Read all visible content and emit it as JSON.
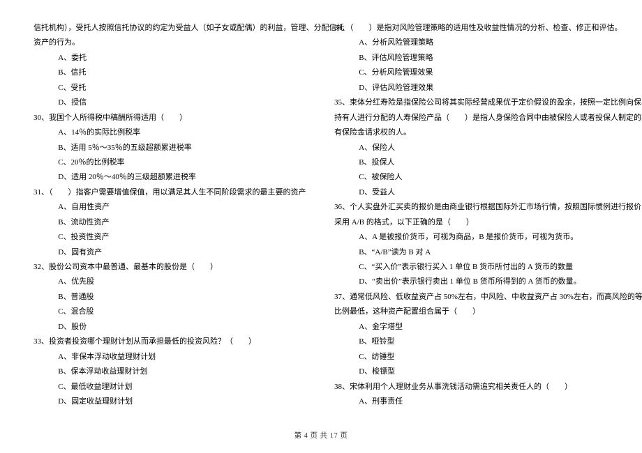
{
  "left": {
    "intro1": "信托机构），受托人按照信托协议的约定为受益人（如子女或配偶）的利益，管理、分配信托",
    "intro2": "资产的行为。",
    "q29": {
      "A": "A、委托",
      "B": "B、信托",
      "C": "C、受托",
      "D": "D、授信"
    },
    "q30": {
      "stem": "30、我国个人所得税中稿酬所得适用（　　）",
      "A": "A、14％的实际比例税率",
      "B": "B、适用 5％～35％的五级超额累进税率",
      "C": "C、20％的比例税率",
      "D": "D、适用 20％～40％的三级超额累进税率"
    },
    "q31": {
      "stem": "31、（　　）指客户需要增值保值，用以满足其人生不同阶段需求的最主要的资产",
      "A": "A、自用性资产",
      "B": "B、流动性资产",
      "C": "C、投资性资产",
      "D": "D、固有资产"
    },
    "q32": {
      "stem": "32、股份公司资本中最普通、最基本的股份是（　　）",
      "A": "A、优先股",
      "B": "B、普通股",
      "C": "C、混合股",
      "D": "D、股份"
    },
    "q33": {
      "stem": "33、投资者投资哪个理财计划从而承担最低的投资风险？（　　）",
      "A": "A、非保本浮动收益理财计划",
      "B": "B、保本浮动收益理财计划",
      "C": "C、最低收益理财计划",
      "D": "D、固定收益理财计划"
    }
  },
  "right": {
    "q34": {
      "stem": "34、（　　）是指对风险管理策略的适用性及收益性情况的分析、检查、修正和评估。",
      "A": "A、分析风险管理策略",
      "B": "B、评估风险管理策略",
      "C": "C、分析风险管理效果",
      "D": "D、评估风险管理效果"
    },
    "q35": {
      "s1": "35、束体分红寿险是指保险公司将其实际经营成果优于定价假设的盈余，按照一定比例向保单",
      "s2": "持有人进行分配的人寿保险产品（　　）是指人身保险合同中由被保险人或者投保人制定的享",
      "s3": "有保险金请求权的人。",
      "A": "A、保险人",
      "B": "B、投保人",
      "C": "C、被保险人",
      "D": "D、受益人"
    },
    "q36": {
      "s1": "36、个人实盘外汇买卖的报价是由商业银行根据国际外汇市场行情，按照国际惯例进行报价，",
      "s2": "采用 A/B 的格式，以下正确的是（　　）",
      "A": "A、A 是被报价货币，可视为商品，B 是报价货币，可视为货币。",
      "B": "B、“A/B”读为 B 对 A",
      "C": "C、“买入价”表示银行买入 1 单位 B 货币所付出的 A 货币的数量",
      "D": "D、“卖出价”表示银行卖出 1 单位 B 货币所得到的 A 货币的数量。"
    },
    "q37": {
      "s1": "37、通常低风险、低收益资产占 50%左右，中风险、中收益资产占 30%左右，而高风险的等资产",
      "s2": "比例最低，这种资产配置组合属于（　　）",
      "A": "A、金字塔型",
      "B": "B、哑铃型",
      "C": "C、纺锤型",
      "D": "D、梭镖型"
    },
    "q38": {
      "stem": "38、宋体利用个人理财业务从事洗钱活动需追究相关责任人的（　　）",
      "A": "A、刑事责任"
    }
  },
  "footer": "第 4 页 共 17 页"
}
